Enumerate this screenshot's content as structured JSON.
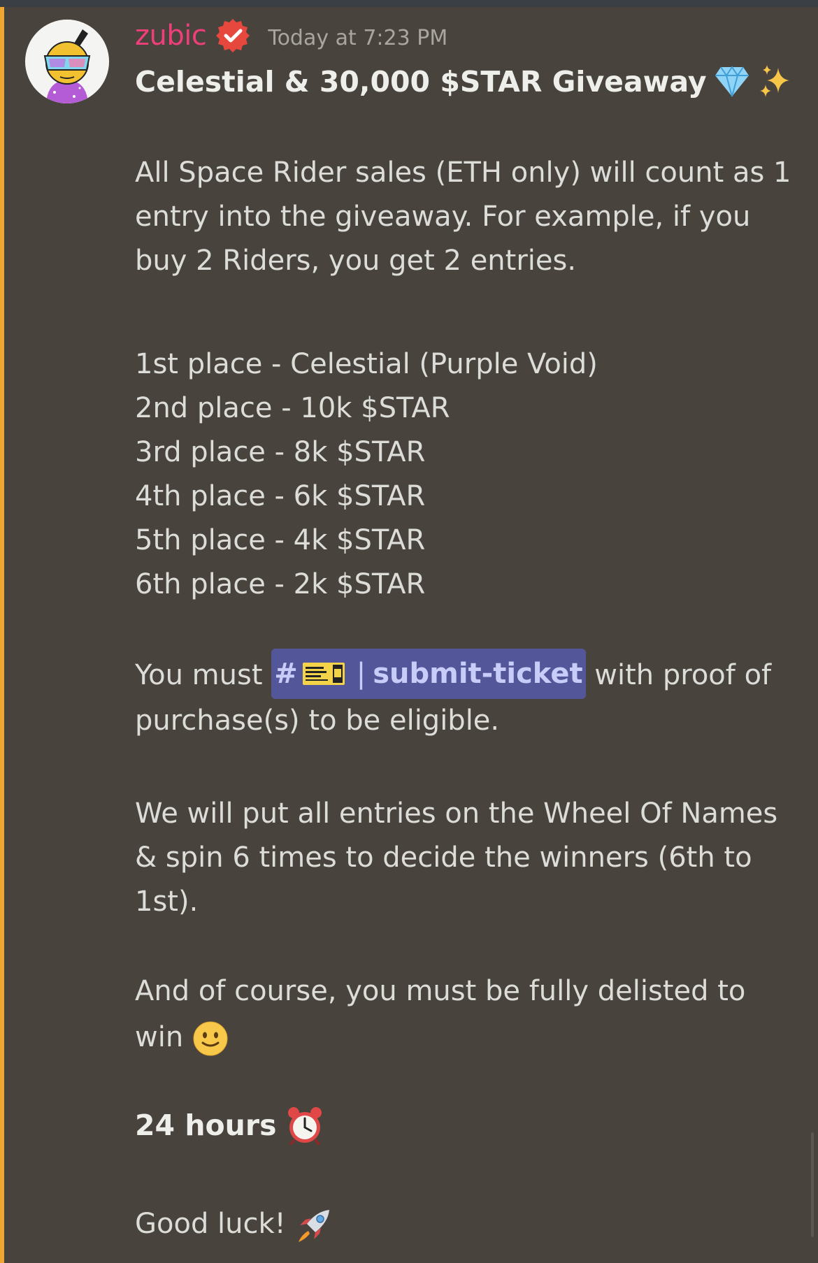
{
  "message": {
    "username": "zubic",
    "timestamp": "Today at 7:23 PM",
    "title": "Celestial & 30,000 $STAR Giveaway",
    "para1": [
      "All Space Rider sales (ETH only) will count as 1",
      "entry into the giveaway. For example, if you",
      "buy 2 Riders, you get 2 entries."
    ],
    "prizes": [
      "1st place - Celestial (Purple Void)",
      "2nd place - 10k $STAR",
      "3rd place - 8k $STAR",
      "4th place - 6k $STAR",
      "5th place - 4k $STAR",
      "6th place - 2k $STAR"
    ],
    "para2_prefix": "You must",
    "channel": {
      "hash": "#",
      "divider": "|",
      "name": "submit-ticket",
      "icon": "ticket-icon"
    },
    "para2_suffix": "with proof of",
    "para2_line2": "purchase(s) to be eligible.",
    "para3": [
      "We will put all entries on the Wheel Of Names",
      "& spin 6 times to decide the winners (6th to",
      "1st)."
    ],
    "para4": [
      "And of course, you must be fully delisted to",
      "win"
    ],
    "duration": "24 hours",
    "closing": "Good luck!"
  },
  "icons": {
    "verified": "verified-badge-icon",
    "title_emojis": [
      "gem-icon",
      "sparkles-icon"
    ],
    "smile": "slightly-smiling-face-icon",
    "alarm": "alarm-clock-icon",
    "rocket": "rocket-icon"
  },
  "colors": {
    "background": "#48433d",
    "username": "#ee3f7a",
    "mention_bar": "#f0a630",
    "channel_chip_bg": "#54569a",
    "channel_chip_text": "#c7cdf8"
  }
}
